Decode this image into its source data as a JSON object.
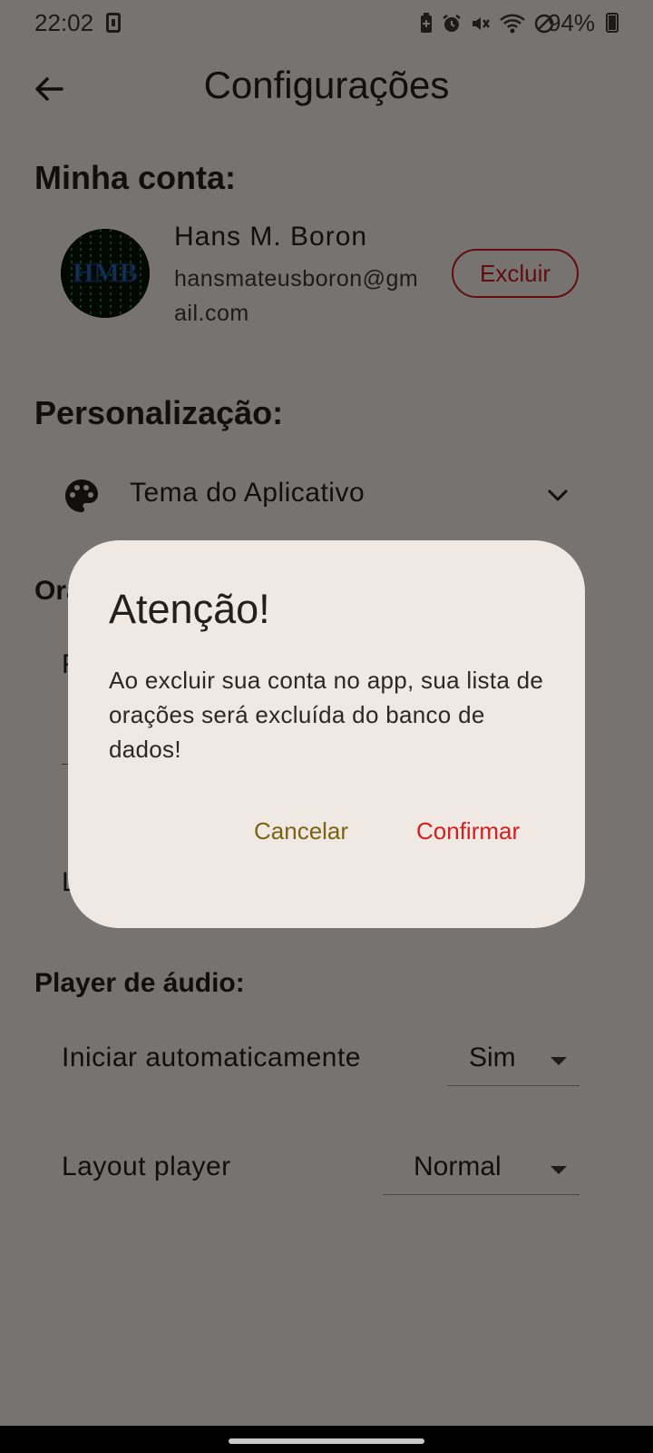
{
  "status_bar": {
    "time": "22:02",
    "battery": "94%",
    "icons": [
      "sim-card-icon",
      "battery-saver-icon",
      "alarm-icon",
      "mute-icon",
      "wifi-icon",
      "do-not-disturb-icon",
      "battery-charging-icon"
    ]
  },
  "app_bar": {
    "title": "Configurações",
    "back_icon": "arrow-left-icon"
  },
  "account": {
    "section_title": "Minha conta:",
    "avatar_text": "HMB",
    "name": "Hans M. Boron",
    "email": "hansmateusboron@gmail.com",
    "delete_label": "Excluir"
  },
  "personalization": {
    "section_title": "Personalização:",
    "theme_label": "Tema do Aplicativo",
    "theme_icon": "palette-icon",
    "expand_icon": "chevron-down-icon"
  },
  "hidden_section": {
    "title_peek": "Ora",
    "row1_peek": "F",
    "row2_peek": "L"
  },
  "audio_player": {
    "section_title": "Player de áudio:",
    "autoplay_label": "Iniciar automaticamente",
    "autoplay_value": "Sim",
    "layout_label": "Layout player",
    "layout_value": "Normal"
  },
  "dialog": {
    "title": "Atenção!",
    "body": "Ao excluir sua conta no app, sua lista de orações será excluída do banco de dados!",
    "cancel_label": "Cancelar",
    "confirm_label": "Confirmar"
  },
  "colors": {
    "danger": "#c21a1a",
    "cancel": "#7a6411",
    "surface": "#ede6e1",
    "dialog_surface": "#efe8e3"
  }
}
